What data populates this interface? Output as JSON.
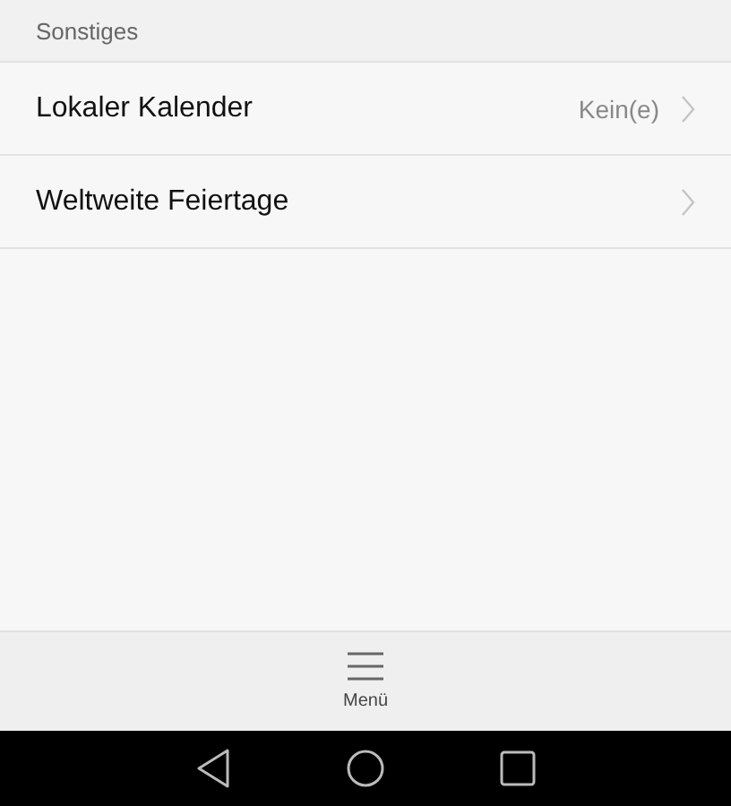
{
  "section": {
    "title": "Sonstiges"
  },
  "rows": [
    {
      "label": "Lokaler Kalender",
      "value": "Kein(e)"
    },
    {
      "label": "Weltweite Feiertage"
    }
  ],
  "bottom_bar": {
    "menu_label": "Menü"
  }
}
